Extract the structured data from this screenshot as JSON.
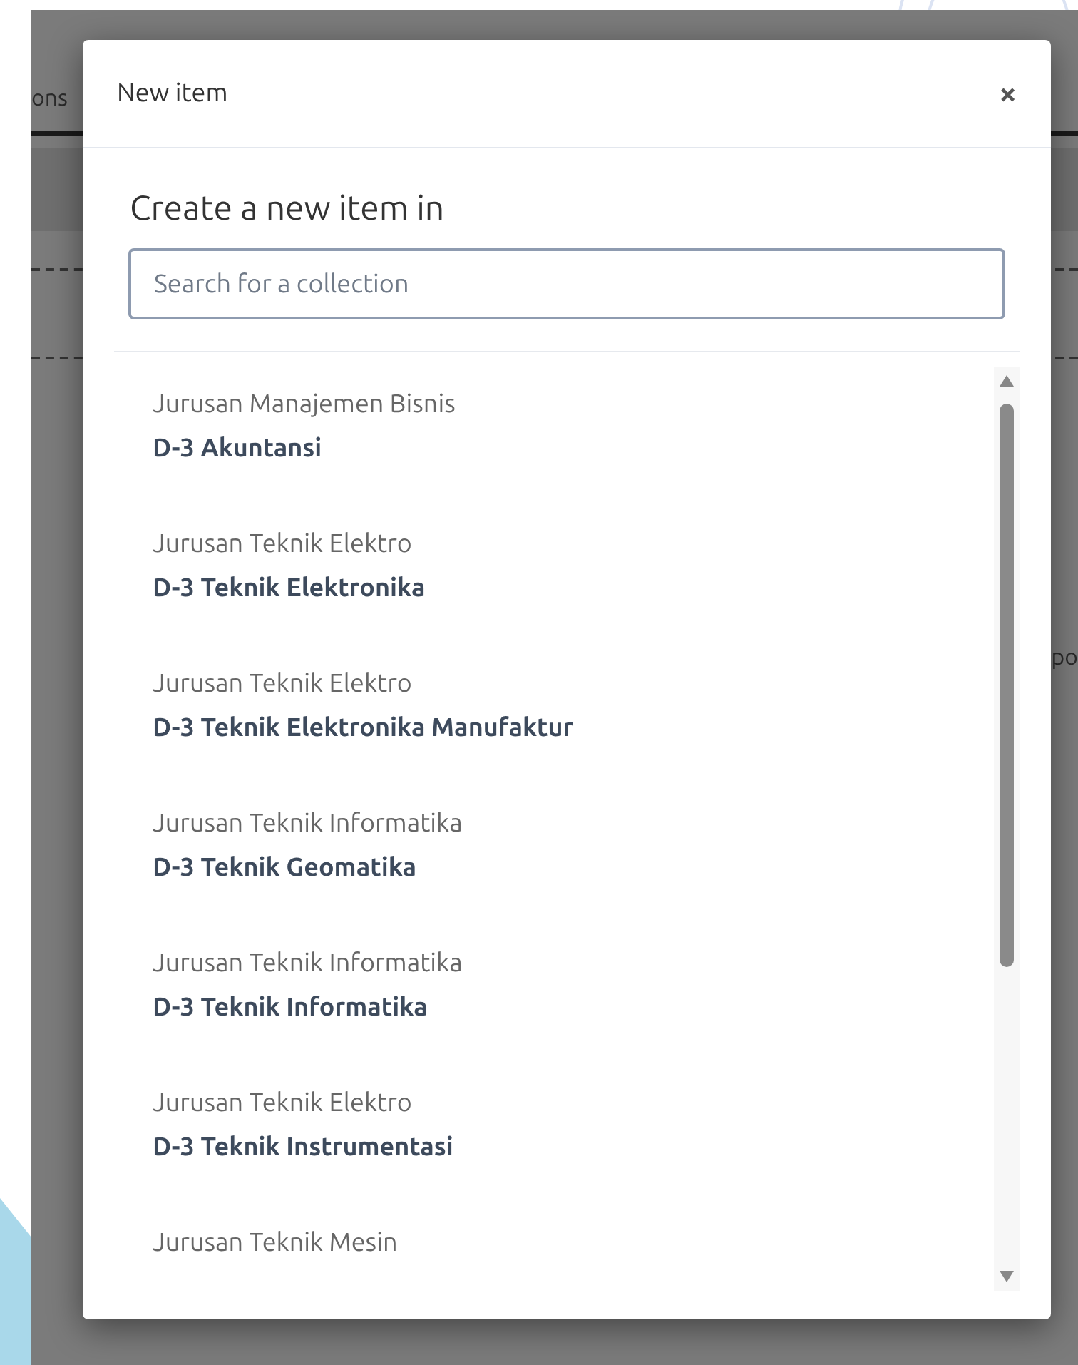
{
  "background": {
    "tab_fragment": "ons",
    "text_fragment": "po"
  },
  "dialog": {
    "title": "New item",
    "close": "×",
    "heading": "Create a new item in",
    "search": {
      "placeholder": "Search for a collection"
    },
    "items": [
      {
        "department": "Jurusan Manajemen Bisnis",
        "program": "D-3 Akuntansi"
      },
      {
        "department": "Jurusan Teknik Elektro",
        "program": "D-3 Teknik Elektronika"
      },
      {
        "department": "Jurusan Teknik Elektro",
        "program": "D-3 Teknik Elektronika Manufaktur"
      },
      {
        "department": "Jurusan Teknik Informatika",
        "program": "D-3 Teknik Geomatika"
      },
      {
        "department": "Jurusan Teknik Informatika",
        "program": "D-3 Teknik Informatika"
      },
      {
        "department": "Jurusan Teknik Elektro",
        "program": "D-3 Teknik Instrumentasi"
      },
      {
        "department": "Jurusan Teknik Mesin"
      }
    ]
  }
}
